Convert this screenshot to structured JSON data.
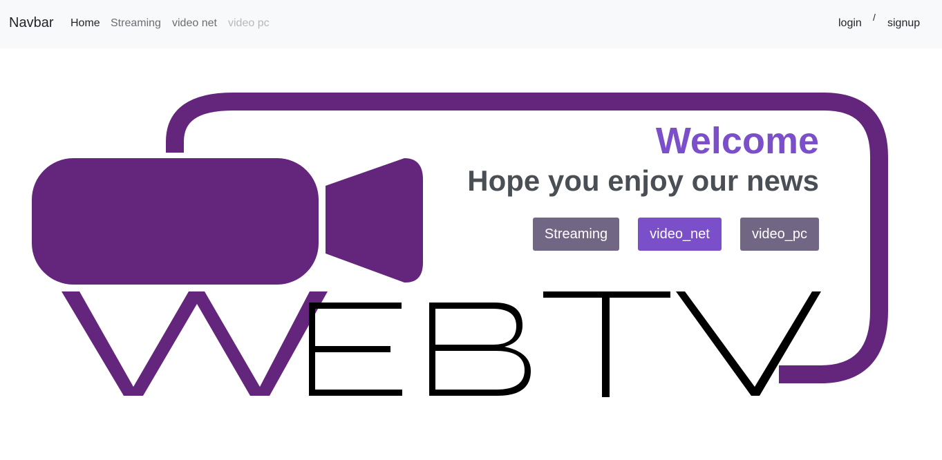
{
  "navbar": {
    "brand": "Navbar",
    "links": [
      {
        "label": "Home",
        "state": "active"
      },
      {
        "label": "Streaming",
        "state": "normal"
      },
      {
        "label": "video net",
        "state": "normal"
      },
      {
        "label": "video pc",
        "state": "disabled"
      }
    ],
    "auth": {
      "login": "login",
      "separator": "/",
      "signup": "signup"
    }
  },
  "hero": {
    "welcome": "Welcome",
    "tagline": "Hope you enjoy our news",
    "buttons": [
      {
        "label": "Streaming"
      },
      {
        "label": "video_net"
      },
      {
        "label": "video_pc"
      }
    ],
    "logo": {
      "text": "WEBTV",
      "icon": "video-camera-icon"
    }
  },
  "colors": {
    "logo_purple": "#64267d",
    "welcome_purple": "#7b4fc9",
    "button_gray": "#716785",
    "navbar_bg": "#f8f9fa",
    "text_dark": "#212529"
  }
}
